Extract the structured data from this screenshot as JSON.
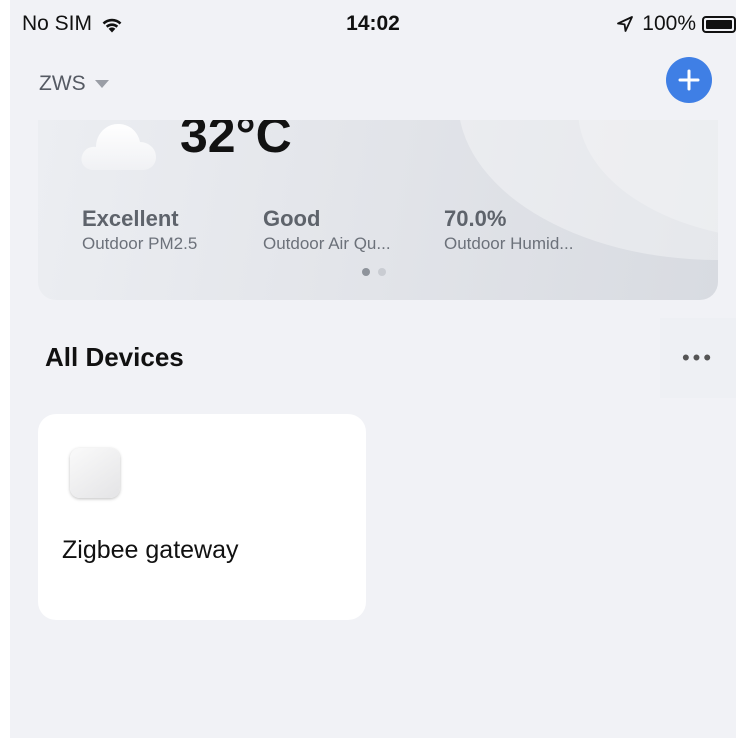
{
  "status_bar": {
    "carrier": "No SIM",
    "time": "14:02",
    "battery": "100%"
  },
  "header": {
    "home_name": "ZWS",
    "icons": [
      "caret-down-icon",
      "add-icon"
    ]
  },
  "weather": {
    "temperature": "32°C",
    "icon": "cloud-icon",
    "metrics": [
      {
        "value": "Excellent",
        "label": "Outdoor PM2.5"
      },
      {
        "value": "Good",
        "label": "Outdoor Air Qu..."
      },
      {
        "value": "70.0%",
        "label": "Outdoor Humid..."
      }
    ],
    "page_count": 2,
    "active_page": 1
  },
  "devices_section": {
    "title": "All Devices",
    "more_label": "•••"
  },
  "devices": [
    {
      "name": "Zigbee gateway",
      "icon": "gateway-device-icon"
    }
  ],
  "colors": {
    "background": "#f1f2f6",
    "accent": "#3f7fe5",
    "card": "#ffffff",
    "pager_active": "#8e939b",
    "pager_inactive": "#c9ccd2"
  }
}
